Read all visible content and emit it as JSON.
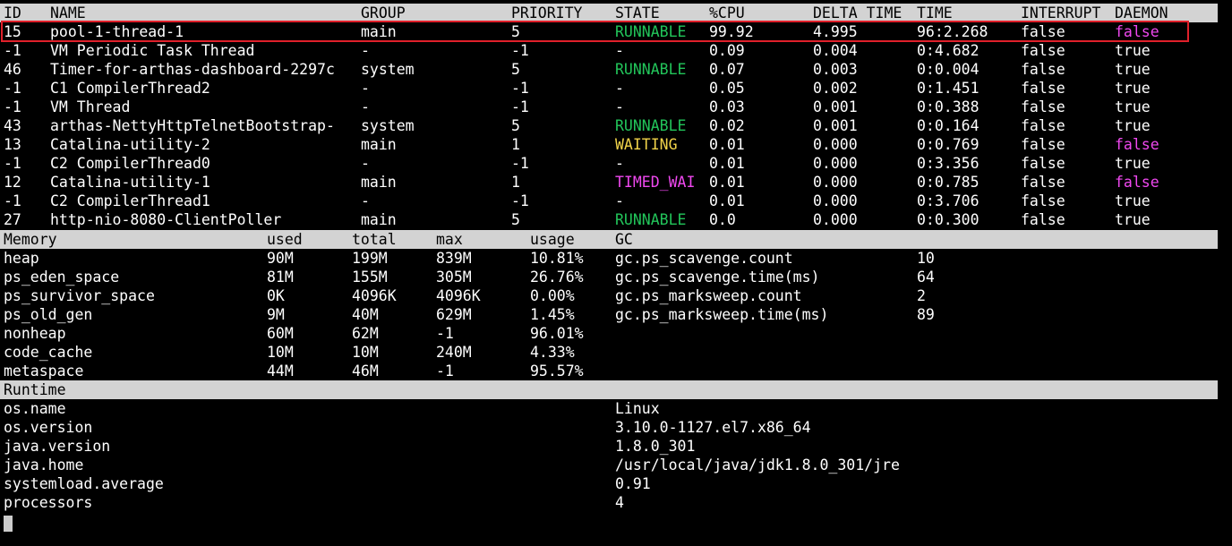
{
  "thread_header": {
    "id": "ID",
    "name": "NAME",
    "group": "GROUP",
    "priority": "PRIORITY",
    "state": "STATE",
    "cpu": "%CPU",
    "delta_time": "DELTA_TIME",
    "time": "TIME",
    "interrupt": "INTERRUPT",
    "daemon": "DAEMON"
  },
  "threads": [
    {
      "id": "15",
      "name": "pool-1-thread-1",
      "group": "main",
      "priority": "5",
      "state": "RUNNABLE",
      "state_color": "#22c55a",
      "cpu": "99.92",
      "delta": "4.995",
      "time": "96:2.268",
      "interrupt": "false",
      "daemon": "false",
      "highlighted": true
    },
    {
      "id": "-1",
      "name": "VM Periodic Task Thread",
      "group": "-",
      "priority": "-1",
      "state": "-",
      "cpu": "0.09",
      "delta": "0.004",
      "time": "0:4.682",
      "interrupt": "false",
      "daemon": "true"
    },
    {
      "id": "46",
      "name": "Timer-for-arthas-dashboard-2297c",
      "group": "system",
      "priority": "5",
      "state": "RUNNABLE",
      "state_color": "#22c55a",
      "cpu": "0.07",
      "delta": "0.003",
      "time": "0:0.004",
      "interrupt": "false",
      "daemon": "true"
    },
    {
      "id": "-1",
      "name": "C1 CompilerThread2",
      "group": "-",
      "priority": "-1",
      "state": "-",
      "cpu": "0.05",
      "delta": "0.002",
      "time": "0:1.451",
      "interrupt": "false",
      "daemon": "true"
    },
    {
      "id": "-1",
      "name": "VM Thread",
      "group": "-",
      "priority": "-1",
      "state": "-",
      "cpu": "0.03",
      "delta": "0.001",
      "time": "0:0.388",
      "interrupt": "false",
      "daemon": "true"
    },
    {
      "id": "43",
      "name": "arthas-NettyHttpTelnetBootstrap-",
      "group": "system",
      "priority": "5",
      "state": "RUNNABLE",
      "state_color": "#22c55a",
      "cpu": "0.02",
      "delta": "0.001",
      "time": "0:0.164",
      "interrupt": "false",
      "daemon": "true"
    },
    {
      "id": "13",
      "name": "Catalina-utility-2",
      "group": "main",
      "priority": "1",
      "state": "WAITING",
      "state_color": "#f2d44a",
      "cpu": "0.01",
      "delta": "0.000",
      "time": "0:0.769",
      "interrupt": "false",
      "daemon": "false"
    },
    {
      "id": "-1",
      "name": "C2 CompilerThread0",
      "group": "-",
      "priority": "-1",
      "state": "-",
      "cpu": "0.01",
      "delta": "0.000",
      "time": "0:3.356",
      "interrupt": "false",
      "daemon": "true"
    },
    {
      "id": "12",
      "name": "Catalina-utility-1",
      "group": "main",
      "priority": "1",
      "state": "TIMED_WAI",
      "state_color": "#f048f0",
      "cpu": "0.01",
      "delta": "0.000",
      "time": "0:0.785",
      "interrupt": "false",
      "daemon": "false"
    },
    {
      "id": "-1",
      "name": "C2 CompilerThread1",
      "group": "-",
      "priority": "-1",
      "state": "-",
      "cpu": "0.01",
      "delta": "0.000",
      "time": "0:3.706",
      "interrupt": "false",
      "daemon": "true"
    },
    {
      "id": "27",
      "name": "http-nio-8080-ClientPoller",
      "group": "main",
      "priority": "5",
      "state": "RUNNABLE",
      "state_color": "#22c55a",
      "cpu": "0.0",
      "delta": "0.000",
      "time": "0:0.300",
      "interrupt": "false",
      "daemon": "true"
    }
  ],
  "memory_header": {
    "memory": "Memory",
    "used": "used",
    "total": "total",
    "max": "max",
    "usage": "usage",
    "gc": "GC"
  },
  "memory": [
    {
      "name": "heap",
      "used": "90M",
      "total": "199M",
      "max": "839M",
      "usage": "10.81%",
      "gc_key": "gc.ps_scavenge.count",
      "gc_val": "10"
    },
    {
      "name": "ps_eden_space",
      "used": "81M",
      "total": "155M",
      "max": "305M",
      "usage": "26.76%",
      "gc_key": "gc.ps_scavenge.time(ms)",
      "gc_val": "64"
    },
    {
      "name": "ps_survivor_space",
      "used": "0K",
      "total": "4096K",
      "max": "4096K",
      "usage": "0.00%",
      "gc_key": "gc.ps_marksweep.count",
      "gc_val": "2"
    },
    {
      "name": "ps_old_gen",
      "used": "9M",
      "total": "40M",
      "max": "629M",
      "usage": "1.45%",
      "gc_key": "gc.ps_marksweep.time(ms)",
      "gc_val": "89"
    },
    {
      "name": "nonheap",
      "used": "60M",
      "total": "62M",
      "max": "-1",
      "usage": "96.01%",
      "gc_key": "",
      "gc_val": ""
    },
    {
      "name": "code_cache",
      "used": "10M",
      "total": "10M",
      "max": "240M",
      "usage": "4.33%",
      "gc_key": "",
      "gc_val": ""
    },
    {
      "name": "metaspace",
      "used": "44M",
      "total": "46M",
      "max": "-1",
      "usage": "95.57%",
      "gc_key": "",
      "gc_val": ""
    }
  ],
  "runtime_header": "Runtime",
  "runtime": [
    {
      "key": "os.name",
      "value": "Linux"
    },
    {
      "key": "os.version",
      "value": "3.10.0-1127.el7.x86_64"
    },
    {
      "key": "java.version",
      "value": "1.8.0_301"
    },
    {
      "key": "java.home",
      "value": "/usr/local/java/jdk1.8.0_301/jre"
    },
    {
      "key": "systemload.average",
      "value": "0.91"
    },
    {
      "key": "processors",
      "value": "4"
    }
  ],
  "colors": {
    "runnable": "#22c55a",
    "waiting": "#f2d44a",
    "timed_waiting": "#f048f0",
    "daemon_false": "#f048f0",
    "highlight_border": "#e0202a"
  }
}
